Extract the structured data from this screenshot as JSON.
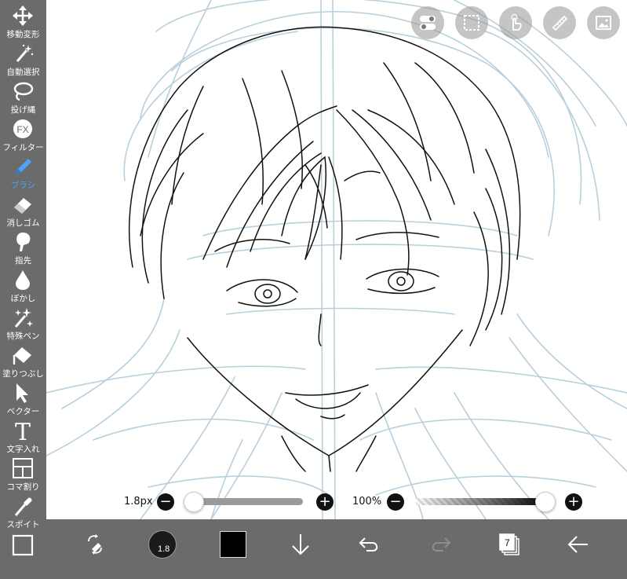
{
  "toolbar": {
    "tools": [
      {
        "label": "移動変形",
        "icon": "move-icon"
      },
      {
        "label": "自動選択",
        "icon": "magic-wand-icon"
      },
      {
        "label": "投げ縄",
        "icon": "lasso-icon"
      },
      {
        "label": "フィルター",
        "icon": "fx-icon",
        "fx": "FX"
      },
      {
        "label": "ブラシ",
        "icon": "brush-icon",
        "active": true
      },
      {
        "label": "消しゴム",
        "icon": "eraser-icon"
      },
      {
        "label": "指先",
        "icon": "smudge-icon"
      },
      {
        "label": "ぼかし",
        "icon": "blur-drop-icon"
      },
      {
        "label": "特殊ペン",
        "icon": "sparkle-pen-icon"
      },
      {
        "label": "塗りつぶし",
        "icon": "fill-bucket-icon"
      },
      {
        "label": "ベクター",
        "icon": "vector-arrow-icon"
      },
      {
        "label": "文字入れ",
        "icon": "text-icon",
        "glyph": "T"
      },
      {
        "label": "コマ割り",
        "icon": "frame-divide-icon"
      },
      {
        "label": "スポイト",
        "icon": "eyedropper-icon"
      },
      {
        "label": "",
        "icon": "canvas-square-icon"
      }
    ]
  },
  "sliders": {
    "brush_size": "1.8px",
    "brush_size_level": 0.0,
    "opacity": "100%",
    "opacity_level": 1.0,
    "minus": "−",
    "plus": "+"
  },
  "bottom": {
    "brush_size_badge": "1.8",
    "current_color": "#000000",
    "layer_count": "7"
  },
  "colors": {
    "accent": "#4da3ff",
    "toolbar_bg": "#6b6b6b",
    "sketch_blue": "#b8cfdc",
    "ink": "#111111"
  }
}
